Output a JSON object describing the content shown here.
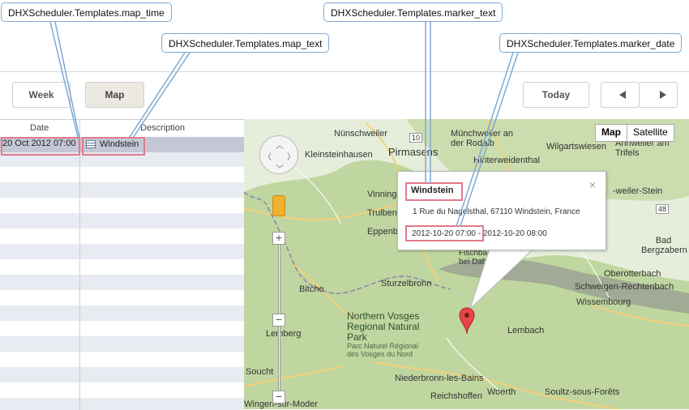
{
  "callouts": {
    "map_time": "DHXScheduler.Templates.map_time",
    "map_text": "DHXScheduler.Templates.map_text",
    "marker_text": "DHXScheduler.Templates.marker_text",
    "marker_date": "DHXScheduler.Templates.marker_date"
  },
  "toolbar": {
    "week_label": "Week",
    "map_label": "Map",
    "today_label": "Today",
    "prev_icon": "left-arrow-icon",
    "next_icon": "right-arrow-icon"
  },
  "grid": {
    "headers": {
      "date": "Date",
      "description": "Description"
    },
    "rows": [
      {
        "date": "20 Oct 2012 07:00",
        "description": "Windstein"
      }
    ]
  },
  "map": {
    "type_buttons": {
      "map": "Map",
      "satellite": "Satellite"
    },
    "labels": {
      "nunschweiler": "Nünschweiler",
      "pirmasens": "Pirmasens",
      "munchweiler": "Münchweiler an der Rodalb",
      "wilgartswiesen": "Wilgartswiesen",
      "annweiler": "Annweiler am Trifels",
      "kleinsteinhausen": "Kleinsteinhausen",
      "hinterweidenthal": "Hinterweidenthal",
      "vinning": "Vinning",
      "trulben": "Trulben",
      "eppenbrunn": "Eppenb",
      "weiler_stein": "-weiler-Stein",
      "bad_bergzabern": "Bad Bergzabern",
      "fischbach": "Fischbach bei Dahn",
      "oberotterbach": "Oberotterbach",
      "schweigen": "Schweigen-Rechtenbach",
      "wissembourg": "Wissembourg",
      "bitche": "Bitche",
      "sturzelbronn": "Sturzelbronn",
      "lembach": "Lembach",
      "lemberg": "Lemberg",
      "park_title": "Northern Vosges Regional Natural Park",
      "park_sub": "Parc Naturel Régional des Vosges du Nord",
      "soucht": "Soucht",
      "niederbronn": "Niederbronn-les-Bains",
      "reichshoffen": "Reichshoffen",
      "woerth": "Woerth",
      "soultz": "Soultz-sous-Forêts",
      "wingen": "Wingen-sur-Moder",
      "road_10": "10",
      "road_48": "48"
    },
    "popup": {
      "title": "Windstein",
      "address": "1 Rue du Nagelsthal, 67110 Windstein, France",
      "date_start": "2012-10-20 07:00",
      "date_rest": " - 2012-10-20 08:00",
      "close": "×"
    }
  },
  "colors": {
    "callout_border": "#7ea9d3",
    "highlight": "#e07a8a",
    "row_selected": "#c4c7d6",
    "forest": "#bfd6a0",
    "pin": "#e8454a"
  }
}
